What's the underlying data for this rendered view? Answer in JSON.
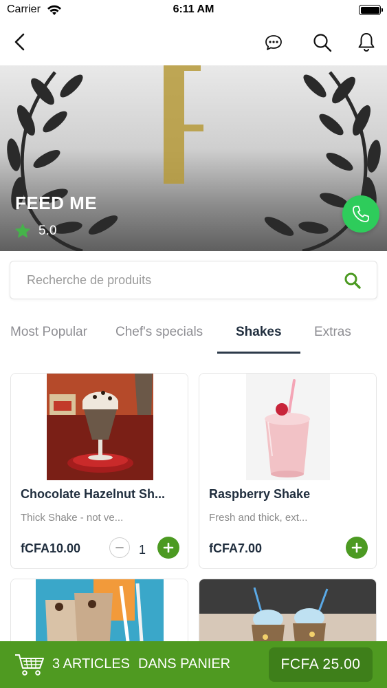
{
  "status_bar": {
    "carrier": "Carrier",
    "time": "6:11 AM"
  },
  "nav": {
    "icons": [
      "back-chevron-icon",
      "chat-bubble-icon",
      "search-icon",
      "bell-icon"
    ]
  },
  "restaurant": {
    "name": "FEED ME",
    "rating": "5.0",
    "rating_icon": "star-icon",
    "call_icon": "phone-icon"
  },
  "search": {
    "placeholder": "Recherche de produits",
    "value": ""
  },
  "tabs": [
    {
      "label": "Most Popular",
      "active": false
    },
    {
      "label": "Chef's specials",
      "active": false
    },
    {
      "label": "Shakes",
      "active": true
    },
    {
      "label": "Extras",
      "active": false
    }
  ],
  "products": [
    {
      "title": "Chocolate Hazelnut Sh...",
      "description": "Thick Shake - not ve...",
      "price": "fCFA10.00",
      "quantity": "1"
    },
    {
      "title": "Raspberry Shake",
      "description": "Fresh and thick, ext...",
      "price": "fCFA7.00",
      "quantity": ""
    }
  ],
  "cart": {
    "count_label": "3 ARTICLES",
    "label": "DANS PANIER",
    "total": "FCFA 25.00"
  },
  "colors": {
    "accent_green": "#4f9a21",
    "call_green": "#2ecc5b",
    "text_dark": "#1f2d3d",
    "text_muted": "#8e8e93"
  }
}
